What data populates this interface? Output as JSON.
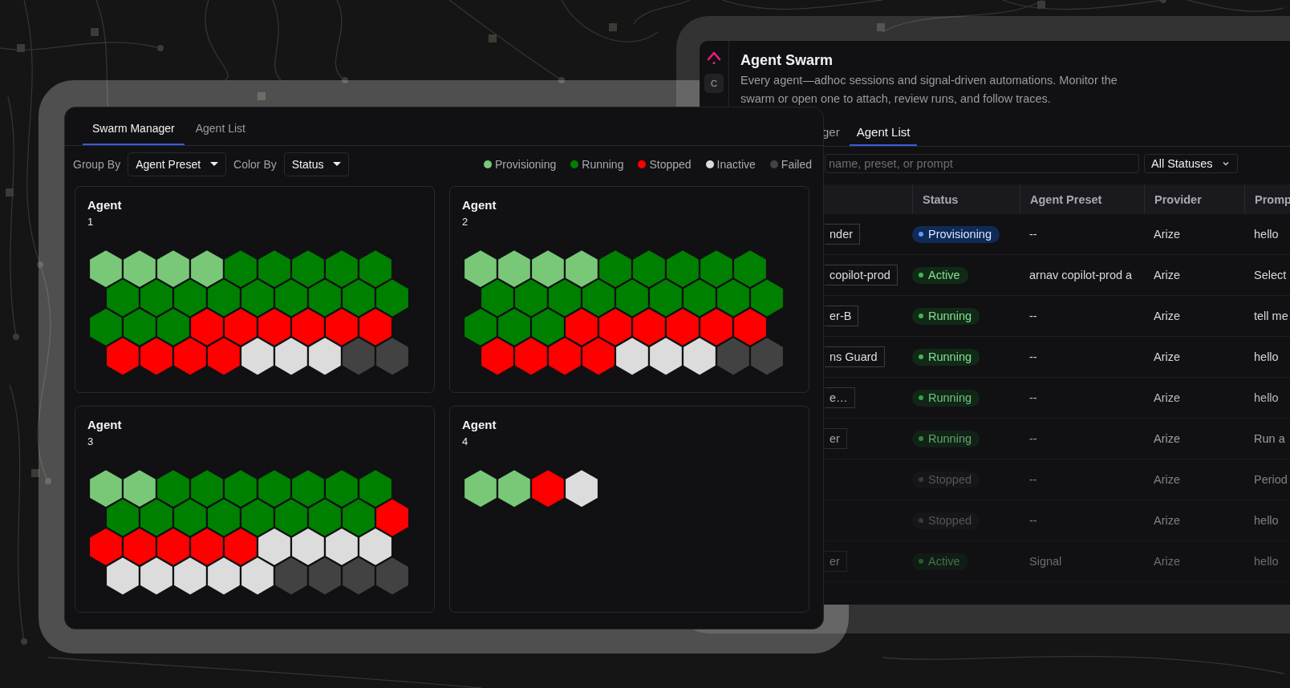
{
  "background_window": {
    "avatar": "C",
    "title": "Agent Swarm",
    "description": "Every agent—adhoc sessions and signal-driven automations. Monitor the swarm or open one to attach, review runs, and follow traces.",
    "tabs": [
      {
        "label": "ger",
        "selected": false
      },
      {
        "label": "Agent List",
        "selected": true
      }
    ],
    "search": {
      "placeholder": "name, preset, or prompt"
    },
    "status_filter": "All Statuses",
    "table": {
      "columns": [
        "Status",
        "Agent Preset",
        "Provider",
        "Promp"
      ],
      "rows": [
        {
          "name": "nder",
          "status": {
            "label": "Provisioning",
            "kind": "provisioning"
          },
          "agent_preset": "--",
          "provider": "Arize",
          "prompt": "hello"
        },
        {
          "name": "copilot-prod",
          "status": {
            "label": "Active",
            "kind": "active"
          },
          "agent_preset": "arnav copilot-prod a",
          "provider": "Arize",
          "prompt": "Select"
        },
        {
          "name": "er-B",
          "status": {
            "label": "Running",
            "kind": "active"
          },
          "agent_preset": "--",
          "provider": "Arize",
          "prompt": "tell me"
        },
        {
          "name": "ns Guard",
          "status": {
            "label": "Running",
            "kind": "active"
          },
          "agent_preset": "--",
          "provider": "Arize",
          "prompt": "hello"
        },
        {
          "name": "e…",
          "status": {
            "label": "Running",
            "kind": "active"
          },
          "agent_preset": "--",
          "provider": "Arize",
          "prompt": "hello"
        },
        {
          "name": "er",
          "status": {
            "label": "Running",
            "kind": "active"
          },
          "agent_preset": "--",
          "provider": "Arize",
          "prompt": "Run a"
        },
        {
          "status": {
            "label": "Stopped",
            "kind": "stopped"
          },
          "agent_preset": "--",
          "provider": "Arize",
          "prompt": "Period"
        },
        {
          "status": {
            "label": "Stopped",
            "kind": "stopped"
          },
          "agent_preset": "--",
          "provider": "Arize",
          "prompt": "hello"
        },
        {
          "name": "er",
          "status": {
            "label": "Active",
            "kind": "active"
          },
          "agent_preset": "Signal",
          "provider": "Arize",
          "prompt": "hello"
        }
      ]
    }
  },
  "swarm_manager": {
    "tabs": [
      {
        "label": "Swarm Manager",
        "selected": true
      },
      {
        "label": "Agent List",
        "selected": false
      }
    ],
    "group_by": {
      "label": "Group By",
      "value": "Agent Preset"
    },
    "color_by": {
      "label": "Color By",
      "value": "Status"
    },
    "legend": [
      {
        "label": "Provisioning",
        "kind": "provisioning",
        "color": "#78c878"
      },
      {
        "label": "Running",
        "kind": "running",
        "color": "#008000"
      },
      {
        "label": "Stopped",
        "kind": "stopped",
        "color": "#ff0000"
      },
      {
        "label": "Inactive",
        "kind": "inactive",
        "color": "#dcdcdc"
      },
      {
        "label": "Failed",
        "kind": "failed",
        "color": "#424242"
      }
    ],
    "cards": [
      {
        "title": "Agent",
        "number": "1",
        "hexes": [
          {
            "kind": "provisioning"
          },
          {
            "kind": "provisioning"
          },
          {
            "kind": "provisioning"
          },
          {
            "kind": "provisioning"
          },
          {
            "kind": "running"
          },
          {
            "kind": "running"
          },
          {
            "kind": "running"
          },
          {
            "kind": "running"
          },
          {
            "kind": "running"
          },
          {
            "kind": "running"
          },
          {
            "kind": "running"
          },
          {
            "kind": "running"
          },
          {
            "kind": "running"
          },
          {
            "kind": "running"
          },
          {
            "kind": "running"
          },
          {
            "kind": "running"
          },
          {
            "kind": "running"
          },
          {
            "kind": "running"
          },
          {
            "kind": "running"
          },
          {
            "kind": "running"
          },
          {
            "kind": "running"
          },
          {
            "kind": "stopped"
          },
          {
            "kind": "stopped"
          },
          {
            "kind": "stopped"
          },
          {
            "kind": "stopped"
          },
          {
            "kind": "stopped"
          },
          {
            "kind": "stopped"
          },
          {
            "kind": "stopped"
          },
          {
            "kind": "stopped"
          },
          {
            "kind": "stopped"
          },
          {
            "kind": "stopped"
          },
          {
            "kind": "inactive"
          },
          {
            "kind": "inactive"
          },
          {
            "kind": "inactive"
          },
          {
            "kind": "failed"
          },
          {
            "kind": "failed"
          }
        ]
      },
      {
        "title": "Agent",
        "number": "2",
        "hexes": [
          {
            "kind": "provisioning"
          },
          {
            "kind": "provisioning"
          },
          {
            "kind": "provisioning"
          },
          {
            "kind": "provisioning"
          },
          {
            "kind": "running"
          },
          {
            "kind": "running"
          },
          {
            "kind": "running"
          },
          {
            "kind": "running"
          },
          {
            "kind": "running"
          },
          {
            "kind": "running"
          },
          {
            "kind": "running"
          },
          {
            "kind": "running"
          },
          {
            "kind": "running"
          },
          {
            "kind": "running"
          },
          {
            "kind": "running"
          },
          {
            "kind": "running"
          },
          {
            "kind": "running"
          },
          {
            "kind": "running"
          },
          {
            "kind": "running"
          },
          {
            "kind": "running"
          },
          {
            "kind": "running"
          },
          {
            "kind": "stopped"
          },
          {
            "kind": "stopped"
          },
          {
            "kind": "stopped"
          },
          {
            "kind": "stopped"
          },
          {
            "kind": "stopped"
          },
          {
            "kind": "stopped"
          },
          {
            "kind": "stopped"
          },
          {
            "kind": "stopped"
          },
          {
            "kind": "stopped"
          },
          {
            "kind": "stopped"
          },
          {
            "kind": "inactive"
          },
          {
            "kind": "inactive"
          },
          {
            "kind": "inactive"
          },
          {
            "kind": "failed"
          },
          {
            "kind": "failed"
          }
        ]
      },
      {
        "title": "Agent",
        "number": "3",
        "hexes": [
          {
            "kind": "provisioning"
          },
          {
            "kind": "provisioning"
          },
          {
            "kind": "running"
          },
          {
            "kind": "running"
          },
          {
            "kind": "running"
          },
          {
            "kind": "running"
          },
          {
            "kind": "running"
          },
          {
            "kind": "running"
          },
          {
            "kind": "running"
          },
          {
            "kind": "running"
          },
          {
            "kind": "running"
          },
          {
            "kind": "running"
          },
          {
            "kind": "running"
          },
          {
            "kind": "running"
          },
          {
            "kind": "running"
          },
          {
            "kind": "running"
          },
          {
            "kind": "running"
          },
          {
            "kind": "stopped"
          },
          {
            "kind": "stopped"
          },
          {
            "kind": "stopped"
          },
          {
            "kind": "stopped"
          },
          {
            "kind": "stopped"
          },
          {
            "kind": "stopped"
          },
          {
            "kind": "inactive"
          },
          {
            "kind": "inactive"
          },
          {
            "kind": "inactive"
          },
          {
            "kind": "inactive"
          },
          {
            "kind": "inactive"
          },
          {
            "kind": "inactive"
          },
          {
            "kind": "inactive"
          },
          {
            "kind": "inactive"
          },
          {
            "kind": "inactive"
          },
          {
            "kind": "failed"
          },
          {
            "kind": "failed"
          },
          {
            "kind": "failed"
          },
          {
            "kind": "failed"
          }
        ]
      },
      {
        "title": "Agent",
        "number": "4",
        "hexes": [
          {
            "kind": "provisioning"
          },
          {
            "kind": "provisioning"
          },
          {
            "kind": "stopped"
          },
          {
            "kind": "inactive"
          }
        ]
      }
    ]
  }
}
